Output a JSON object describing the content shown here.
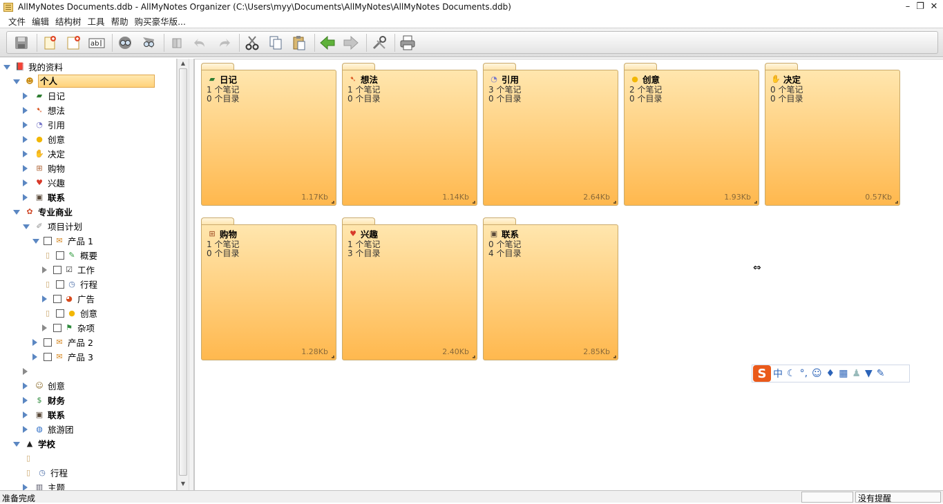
{
  "window": {
    "title": "AllMyNotes Documents.ddb - AllMyNotes Organizer (C:\\Users\\myy\\Documents\\AllMyNotes\\AllMyNotes Documents.ddb)"
  },
  "menu": [
    "文件",
    "编辑",
    "结构树",
    "工具",
    "帮助",
    "购买豪华版..."
  ],
  "toolbar": {
    "buttons": [
      "save-icon",
      "new-note-icon",
      "new-folder-icon",
      "rename-icon",
      "search-icon",
      "search-replace-icon",
      "bookmark-icon",
      "undo-icon",
      "redo-icon",
      "cut-icon",
      "copy-icon",
      "paste-icon",
      "back-icon",
      "forward-icon",
      "options-icon",
      "print-icon"
    ]
  },
  "tree": [
    {
      "label": "我的资料",
      "depth": 0,
      "exp": "open",
      "icon": "book-icon",
      "bold": false
    },
    {
      "label": "个人",
      "depth": 1,
      "exp": "open",
      "icon": "smiley-icon",
      "bold": true,
      "selected": true
    },
    {
      "label": "日记",
      "depth": 2,
      "exp": "closed",
      "icon": "diary-icon"
    },
    {
      "label": "想法",
      "depth": 2,
      "exp": "closed",
      "icon": "idea-bird-icon"
    },
    {
      "label": "引用",
      "depth": 2,
      "exp": "closed",
      "icon": "speech-bubble-icon"
    },
    {
      "label": "创意",
      "depth": 2,
      "exp": "closed",
      "icon": "lightbulb-icon"
    },
    {
      "label": "决定",
      "depth": 2,
      "exp": "closed",
      "icon": "hand-icon"
    },
    {
      "label": "购物",
      "depth": 2,
      "exp": "closed",
      "icon": "cart-icon"
    },
    {
      "label": "兴趣",
      "depth": 2,
      "exp": "closed",
      "icon": "heart-icon"
    },
    {
      "label": "联系",
      "depth": 2,
      "exp": "closed",
      "icon": "contact-card-icon",
      "bold": true
    },
    {
      "label": "专业商业",
      "depth": 1,
      "exp": "open",
      "icon": "people-icon",
      "bold": true
    },
    {
      "label": "项目计划",
      "depth": 2,
      "exp": "open",
      "icon": "pencil-icon"
    },
    {
      "label": "产品 1",
      "depth": 3,
      "exp": "open",
      "icon": "envelope-icon",
      "checkbox": true
    },
    {
      "label": "概要",
      "depth": 4,
      "exp": "page",
      "icon": "pencil-green-icon",
      "checkbox": true
    },
    {
      "label": "工作",
      "depth": 4,
      "exp": "closed-gray",
      "icon": "checkmark-icon",
      "checkbox": true
    },
    {
      "label": "行程",
      "depth": 4,
      "exp": "page",
      "icon": "clock-icon",
      "checkbox": true
    },
    {
      "label": "广告",
      "depth": 4,
      "exp": "closed",
      "icon": "pie-chart-icon",
      "checkbox": true
    },
    {
      "label": "创意",
      "depth": 4,
      "exp": "page",
      "icon": "lightbulb-icon",
      "checkbox": true
    },
    {
      "label": "杂项",
      "depth": 4,
      "exp": "closed-gray",
      "icon": "flag-icon",
      "checkbox": true
    },
    {
      "label": "产品 2",
      "depth": 3,
      "exp": "closed",
      "icon": "envelope-icon",
      "checkbox": true
    },
    {
      "label": "产品 3",
      "depth": 3,
      "exp": "closed",
      "icon": "envelope-icon",
      "checkbox": true
    },
    {
      "label": "",
      "depth": 2,
      "exp": "closed-gray",
      "icon": ""
    },
    {
      "label": "创意",
      "depth": 2,
      "exp": "closed",
      "icon": "globe-smile-icon"
    },
    {
      "label": "财务",
      "depth": 2,
      "exp": "closed",
      "icon": "dollar-icon",
      "bold": true
    },
    {
      "label": "联系",
      "depth": 2,
      "exp": "closed",
      "icon": "contact-card-icon",
      "bold": true
    },
    {
      "label": "旅游团",
      "depth": 2,
      "exp": "closed",
      "icon": "globe-icon"
    },
    {
      "label": "学校",
      "depth": 1,
      "exp": "open",
      "icon": "graduation-cap-icon",
      "bold": true
    },
    {
      "label": "",
      "depth": 2,
      "exp": "page",
      "icon": ""
    },
    {
      "label": "行程",
      "depth": 2,
      "exp": "page",
      "icon": "clock-icon"
    },
    {
      "label": "主题",
      "depth": 2,
      "exp": "closed",
      "icon": "books-icon"
    }
  ],
  "folders": [
    {
      "name": "日记",
      "notes": "1 个笔记",
      "dirs": "0 个目录",
      "size": "1.17Kb",
      "icon": "diary-icon"
    },
    {
      "name": "想法",
      "notes": "1 个笔记",
      "dirs": "0 个目录",
      "size": "1.14Kb",
      "icon": "idea-bird-icon"
    },
    {
      "name": "引用",
      "notes": "3 个笔记",
      "dirs": "0 个目录",
      "size": "2.64Kb",
      "icon": "speech-bubble-icon"
    },
    {
      "name": "创意",
      "notes": "2 个笔记",
      "dirs": "0 个目录",
      "size": "1.93Kb",
      "icon": "lightbulb-icon"
    },
    {
      "name": "决定",
      "notes": "0 个笔记",
      "dirs": "0 个目录",
      "size": "0.57Kb",
      "icon": "hand-icon"
    },
    {
      "name": "购物",
      "notes": "1 个笔记",
      "dirs": "0 个目录",
      "size": "1.28Kb",
      "icon": "cart-icon"
    },
    {
      "name": "兴趣",
      "notes": "1 个笔记",
      "dirs": "3 个目录",
      "size": "2.40Kb",
      "icon": "heart-icon"
    },
    {
      "name": "联系",
      "notes": "0 个笔记",
      "dirs": "4 个目录",
      "size": "2.85Kb",
      "icon": "contact-card-icon"
    }
  ],
  "ime": {
    "logo": "S",
    "mode": "中",
    "items": [
      "moon-icon",
      "punctuation-icon",
      "emoji-icon",
      "microphone-icon",
      "keyboard-icon",
      "user-icon",
      "skin-icon",
      "settings-icon"
    ]
  },
  "status": {
    "left": "准备完成",
    "right": "没有提醒"
  }
}
